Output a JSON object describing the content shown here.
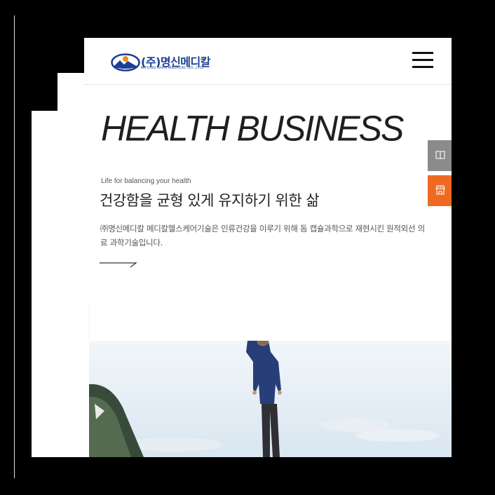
{
  "header": {
    "logo_ko": "(주)명신메디칼",
    "logo_en": "MYUNG SHIN MEDICAL CO.,LTD."
  },
  "hero": {
    "title": "HEALTH BUSINESS",
    "subtitle_en": "Life for balancing your health",
    "subtitle_ko": "건강함을 균형 있게 유지하기 위한 삶",
    "description": "㈜명신메디칼 메디칼헬스케어기술은 인류건강을 이루기 위해 돔 캡슐과학으로 재현시킨 원적외선 의료 과학기술입니다."
  },
  "side_buttons": [
    {
      "icon": "book-icon",
      "color": "#8b8b8b"
    },
    {
      "icon": "store-icon",
      "color": "#ee6a23"
    }
  ],
  "colors": {
    "brand_blue": "#1d3f93",
    "accent_orange": "#ee6a23",
    "gray_button": "#8b8b8b"
  }
}
